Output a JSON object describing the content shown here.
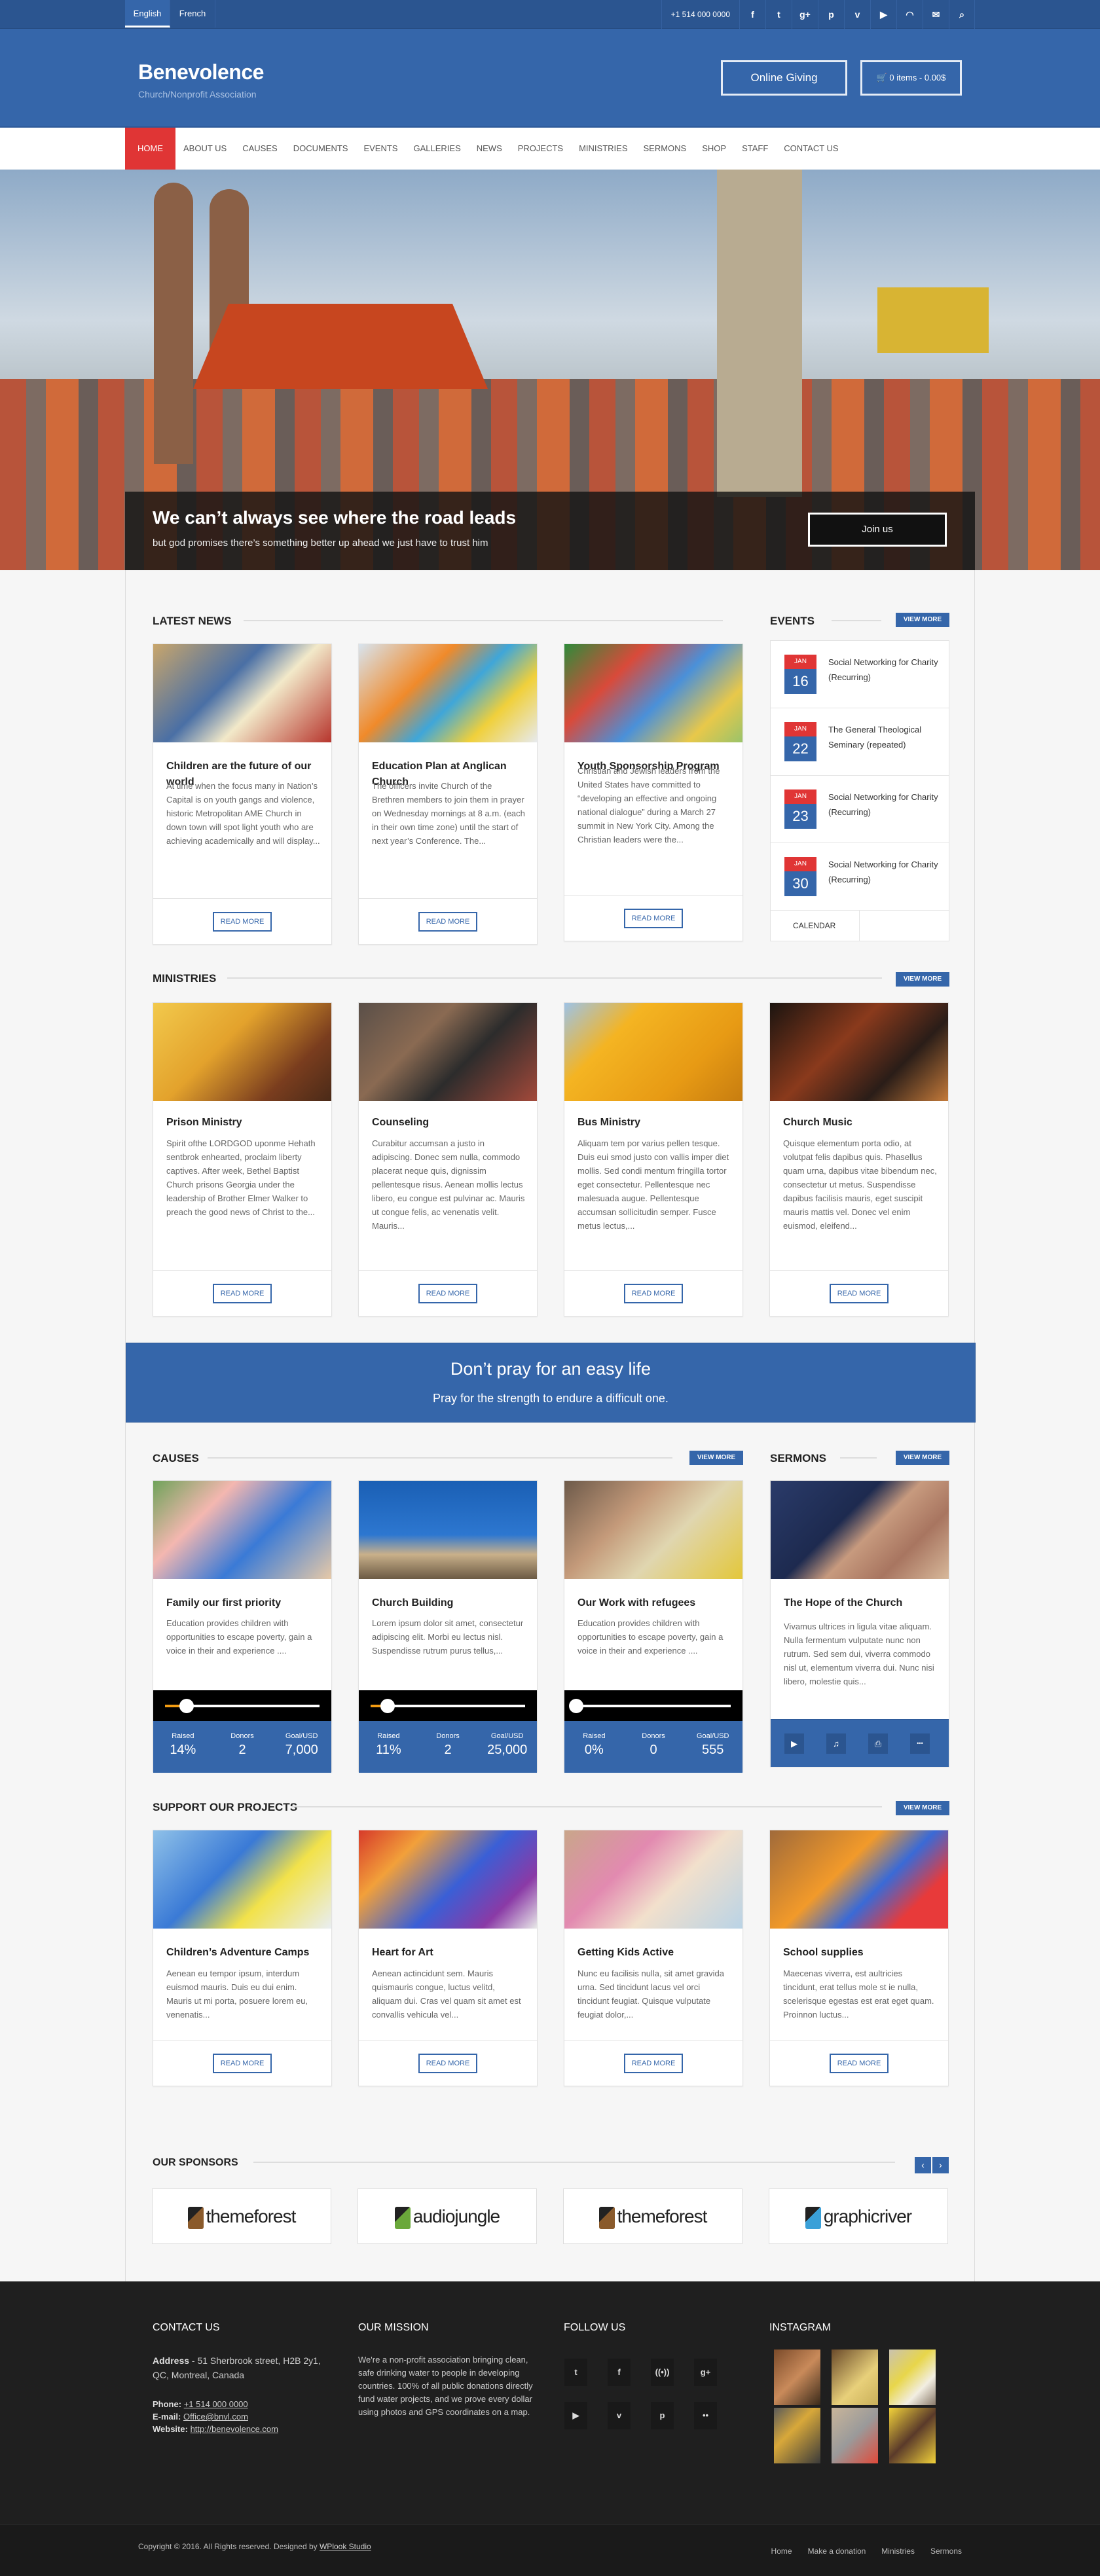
{
  "topbar": {
    "languages": [
      {
        "label": "English",
        "active": true
      },
      {
        "label": "French",
        "active": false
      }
    ],
    "phone": "+1 514 000 0000",
    "icons": [
      "facebook-icon",
      "twitter-icon",
      "google-plus-icon",
      "pinterest-icon",
      "vimeo-icon",
      "youtube-icon",
      "rss-icon",
      "email-icon",
      "search-icon"
    ],
    "icon_glyphs": [
      "f",
      "t",
      "g+",
      "p",
      "v",
      "▶",
      "◠",
      "✉",
      "⌕"
    ]
  },
  "header": {
    "site_title": "Benevolence",
    "tagline": "Church/Nonprofit Association",
    "online_giving": "Online Giving",
    "cart": "0 items - 0.00$",
    "cart_icon": "🛒"
  },
  "nav": {
    "items": [
      "Home",
      "About Us",
      "Causes",
      "Documents",
      "Events",
      "Galleries",
      "News",
      "Projects",
      "Ministries",
      "Sermons",
      "Shop",
      "Staff",
      "Contact Us"
    ],
    "active_index": 0
  },
  "hero": {
    "title": "We can’t always see where the road leads",
    "subtitle": "but god promises there’s something better up ahead we just have to trust him",
    "button": "Join us"
  },
  "latest_news": {
    "title": "Latest News",
    "items": [
      {
        "title": "Children are the future of our world",
        "excerpt": "At time when the focus many in Nation’s Capital is on youth gangs and violence, historic Metropolitan AME Church in down town will spot light youth who are achieving academically and will display...",
        "button": "READ MORE"
      },
      {
        "title": "Education Plan at Anglican Church",
        "excerpt": "The officers invite Church of the Brethren members to join them in prayer on Wednesday mornings at 8 a.m. (each in their own time zone) until the start of next year’s Conference. The...",
        "button": "READ MORE"
      },
      {
        "title": "Youth Sponsorship Program",
        "excerpt": "Christian and Jewish leaders from the United States have committed to “developing an effective and ongoing national dialogue” during a March 27 summit in New York City. Among the Christian leaders were the...",
        "button": "READ MORE"
      }
    ]
  },
  "events": {
    "title": "Events",
    "view_more": "VIEW MORE",
    "items": [
      {
        "month": "JAN",
        "day": "16",
        "title": "Social Networking for Charity (Recurring)"
      },
      {
        "month": "JAN",
        "day": "22",
        "title": "The General Theological Seminary (repeated)"
      },
      {
        "month": "JAN",
        "day": "23",
        "title": "Social Networking for Charity (Recurring)"
      },
      {
        "month": "JAN",
        "day": "30",
        "title": "Social Networking for Charity (Recurring)"
      }
    ],
    "calendar": "CALENDAR"
  },
  "ministries": {
    "title": "Ministries",
    "view_more": "VIEW MORE",
    "items": [
      {
        "title": "Prison Ministry",
        "excerpt": "Spirit ofthe LORDGOD uponme Hehath sentbrok enhearted, proclaim liberty  captives. After week, Bethel Baptist Church prisons Georgia under the leadership of Brother Elmer Walker to preach the good news of Christ to the...",
        "button": "READ MORE"
      },
      {
        "title": "Counseling",
        "excerpt": "Curabitur accumsan a justo in adipiscing. Donec sem nulla, commodo placerat neque quis, dignissim pellentesque risus. Aenean mollis lectus libero, eu congue est pulvinar ac. Mauris ut congue felis, ac venenatis velit. Mauris...",
        "button": "READ MORE"
      },
      {
        "title": "Bus Ministry",
        "excerpt": "Aliquam tem por varius pellen tesque. Duis eui smod justo con vallis imper diet mollis. Sed condi mentum fringilla tortor eget consectetur. Pellentesque nec malesuada augue. Pellentesque accumsan sollicitudin semper. Fusce metus lectus,...",
        "button": "READ MORE"
      },
      {
        "title": "Church Music",
        "excerpt": "Quisque elementum porta odio, at volutpat felis dapibus quis. Phasellus quam urna, dapibus vitae bibendum nec, consectetur ut metus. Suspendisse dapibus facilisis mauris, eget suscipit mauris mattis vel. Donec vel enim euismod, eleifend...",
        "button": "READ MORE"
      }
    ]
  },
  "quote": {
    "line1": "Don’t pray for an easy life",
    "line2": "Pray for the strength to endure a difficult one."
  },
  "causes": {
    "title": "Causes",
    "view_more": "VIEW MORE",
    "labels": {
      "raised": "Raised",
      "donors": "Donors",
      "goal": "Goal/USD"
    },
    "items": [
      {
        "title": "Family our first priority",
        "excerpt": "Education provides children with opportunities to escape poverty, gain a voice in their and experience ....",
        "raised": "14%",
        "raised_fraction": 0.14,
        "donors": "2",
        "goal": "7,000"
      },
      {
        "title": "Church Building",
        "excerpt": "Lorem ipsum dolor sit amet, consectetur adipiscing elit. Morbi eu lectus nisl. Suspendisse rutrum purus tellus,...",
        "raised": "11%",
        "raised_fraction": 0.11,
        "donors": "2",
        "goal": "25,000"
      },
      {
        "title": "Our Work with refugees",
        "excerpt": "Education provides children with opportunities to escape poverty, gain a voice in their and experience ....",
        "raised": "0%",
        "raised_fraction": 0,
        "donors": "0",
        "goal": "555"
      }
    ]
  },
  "sermons": {
    "title": "Sermons",
    "view_more": "VIEW MORE",
    "item": {
      "title": "The Hope of the Church",
      "excerpt": "Vivamus ultrices in ligula vitae aliquam. Nulla fermentum vulputate nunc non rutrum. Sed sem dui, viverra commodo nisl ut, elementum viverra dui. Nunc nisi libero, molestie quis..."
    },
    "media_icons": [
      {
        "name": "video-icon",
        "glyph": "▶"
      },
      {
        "name": "audio-icon",
        "glyph": "♫"
      },
      {
        "name": "pdf-icon",
        "glyph": "⎙"
      },
      {
        "name": "more-icon",
        "glyph": "•••"
      }
    ]
  },
  "projects": {
    "title": "Support Our Projects",
    "view_more": "VIEW MORE",
    "items": [
      {
        "title": "Children’s Adventure Camps",
        "excerpt": "Aenean eu tempor ipsum, interdum euismod mauris. Duis eu dui enim. Mauris ut mi porta, posuere lorem eu, venenatis...",
        "button": "READ MORE"
      },
      {
        "title": "Heart for Art",
        "excerpt": "Aenean actincidunt sem. Mauris quismauris congue, luctus velitd, aliquam dui. Cras vel quam sit amet est convallis vehicula vel...",
        "button": "READ MORE"
      },
      {
        "title": "Getting Kids Active",
        "excerpt": "Nunc eu facilisis nulla, sit amet gravida urna. Sed tincidunt lacus vel orci tincidunt feugiat. Quisque vulputate feugiat dolor,...",
        "button": "READ MORE"
      },
      {
        "title": "School supplies",
        "excerpt": "Maecenas viverra, est aultricies tincidunt, erat tellus mole st ie nulla, scelerisque egestas est erat eget quam. Proinnon luctus...",
        "button": "READ MORE"
      }
    ]
  },
  "sponsors": {
    "title": "Our Sponsors",
    "prev": "‹",
    "next": "›",
    "items": [
      {
        "name": "themeforest",
        "color": "#8a5a2b"
      },
      {
        "name": "audiojungle",
        "color": "#6aa83a"
      },
      {
        "name": "themeforest",
        "color": "#8a5a2b"
      },
      {
        "name": "graphicriver",
        "color": "#3aa0d8"
      }
    ]
  },
  "footer": {
    "contact": {
      "title": "CONTACT US",
      "address_label": "Address",
      "address": " - 51 Sherbrook street, H2B 2y1, QC, Montreal, Canada",
      "phone_label": "Phone:",
      "phone": "+1 514 000 0000",
      "email_label": "E-mail:",
      "email": "Office@bnvl.com",
      "website_label": "Website:",
      "website": "http://benevolence.com"
    },
    "mission": {
      "title": "OUR MISSION",
      "text": "We're a non-profit association bringing clean, safe drinking water to people in developing countries. 100% of all public donations directly fund water projects, and we prove every dollar using photos and GPS coordinates on a map."
    },
    "follow": {
      "title": "FOLLOW US",
      "icons": [
        {
          "name": "twitter-icon",
          "glyph": "t"
        },
        {
          "name": "facebook-icon",
          "glyph": "f"
        },
        {
          "name": "podcast-icon",
          "glyph": "((•))"
        },
        {
          "name": "google-plus-icon",
          "glyph": "g+"
        },
        {
          "name": "youtube-icon",
          "glyph": "▶"
        },
        {
          "name": "vimeo-icon",
          "glyph": "v"
        },
        {
          "name": "pinterest-icon",
          "glyph": "p"
        },
        {
          "name": "flickr-icon",
          "glyph": "••"
        }
      ]
    },
    "instagram": {
      "title": "INSTAGRAM",
      "count": 6
    },
    "copyright": "Copyright © 2016. All Rights reserved. Designed by ",
    "designer": "WPlook Studio",
    "links": [
      "Home",
      "Make a donation",
      "Ministries",
      "Sermons"
    ]
  }
}
